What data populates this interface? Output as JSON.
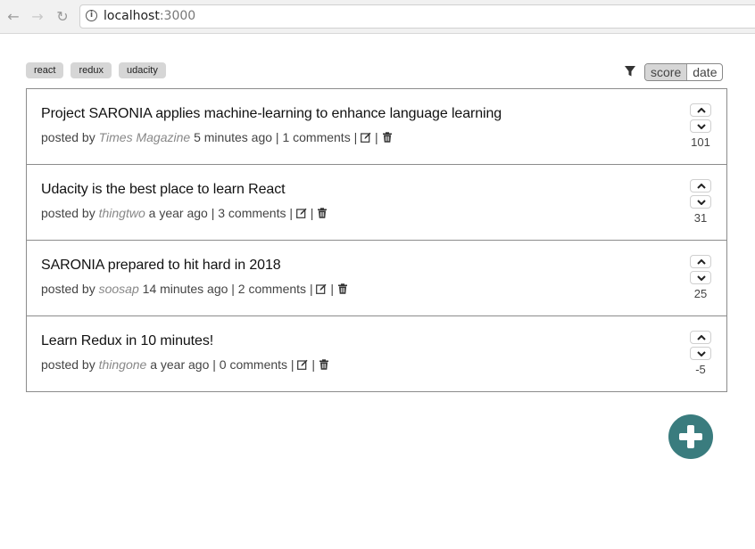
{
  "browser": {
    "url_host": "localhost",
    "url_port": ":3000",
    "back_icon": "arrow-left",
    "forward_icon": "arrow-right",
    "reload_icon": "reload",
    "info_icon": "info-circle"
  },
  "tags": [
    "react",
    "redux",
    "udacity"
  ],
  "sort": {
    "options": [
      "score",
      "date"
    ],
    "active": "score",
    "filter_icon": "funnel"
  },
  "posts": [
    {
      "title": "Project SARONIA applies machine-learning to enhance language learning",
      "posted_by": "posted by ",
      "author": "Times Magazine",
      "time": " 5 minutes ago | 1 comments | ",
      "sep": " | ",
      "score": "101"
    },
    {
      "title": "Udacity is the best place to learn React",
      "posted_by": "posted by ",
      "author": "thingtwo",
      "time": " a year ago | 3 comments | ",
      "sep": " | ",
      "score": "31"
    },
    {
      "title": "SARONIA prepared to hit hard in 2018",
      "posted_by": "posted by ",
      "author": "soosap",
      "time": " 14 minutes ago | 2 comments | ",
      "sep": " | ",
      "score": "25"
    },
    {
      "title": "Learn Redux in 10 minutes!",
      "posted_by": "posted by ",
      "author": "thingone",
      "time": " a year ago | 0 comments | ",
      "sep": " | ",
      "score": "-5"
    }
  ],
  "add_button": {
    "icon": "plus",
    "color": "#3a7c7e"
  },
  "colors": {
    "tag_bg": "#d6d6d6",
    "border": "#8c8c8c",
    "author": "#888888"
  }
}
